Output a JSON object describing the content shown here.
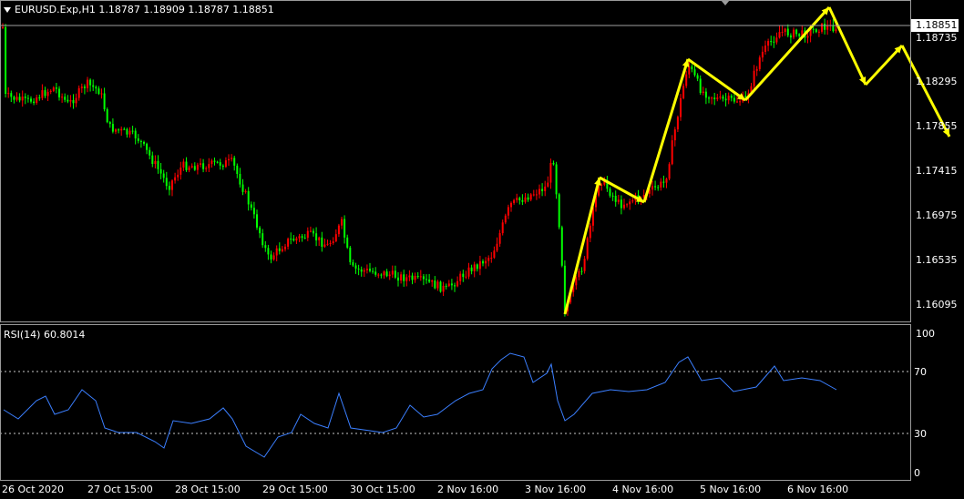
{
  "header": {
    "symbol_line": "EURUSD.Exp,H1  1.18787 1.18909 1.18787 1.18851"
  },
  "rsi": {
    "label": "RSI(14) 60.8014",
    "levels": [
      "100",
      "70",
      "30",
      "0"
    ]
  },
  "price_axis": [
    "1.18735",
    "1.18295",
    "1.17855",
    "1.17415",
    "1.16975",
    "1.16535",
    "1.16095"
  ],
  "current_price": "1.18851",
  "time_axis": [
    "26 Oct 2020",
    "27 Oct 15:00",
    "28 Oct 15:00",
    "29 Oct 15:00",
    "30 Oct 15:00",
    "2 Nov 16:00",
    "3 Nov 16:00",
    "4 Nov 16:00",
    "5 Nov 16:00",
    "6 Nov 16:00"
  ],
  "colors": {
    "bull": "#ff0000",
    "bear": "#00ff00",
    "rsi_line": "#3b7fff",
    "arrow": "#ffff00",
    "grid": "#c8c8c8",
    "background": "#000000"
  }
}
